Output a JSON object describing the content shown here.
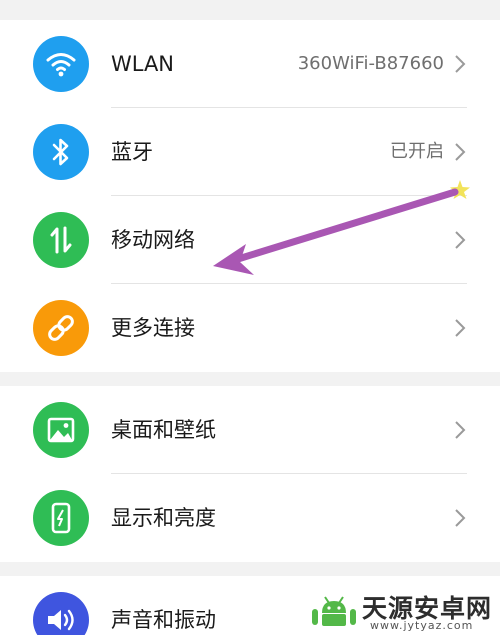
{
  "colors": {
    "wlan_icon_bg": "#1f9fef",
    "bluetooth_icon_bg": "#1f9fef",
    "mobile_icon_bg": "#2fbd55",
    "more_icon_bg": "#f99a09",
    "wallpaper_icon_bg": "#2fbd55",
    "display_icon_bg": "#2fbd55",
    "sound_icon_bg": "#3f55df",
    "annotation_arrow": "#a957b3"
  },
  "settings": {
    "wlan": {
      "label": "WLAN",
      "value": "360WiFi-B87660",
      "icon": "wifi-icon"
    },
    "bluetooth": {
      "label": "蓝牙",
      "value": "已开启",
      "icon": "bluetooth-icon"
    },
    "mobile_network": {
      "label": "移动网络",
      "icon": "mobile-data-icon"
    },
    "more_connections": {
      "label": "更多连接",
      "icon": "link-icon"
    },
    "wallpaper": {
      "label": "桌面和壁纸",
      "icon": "image-icon"
    },
    "display": {
      "label": "显示和亮度",
      "icon": "phone-brightness-icon"
    },
    "sound": {
      "label": "声音和振动",
      "icon": "speaker-icon"
    }
  },
  "watermark": {
    "title": "天源安卓网",
    "url": "www.jytyaz.com",
    "icon": "android-robot-icon"
  }
}
